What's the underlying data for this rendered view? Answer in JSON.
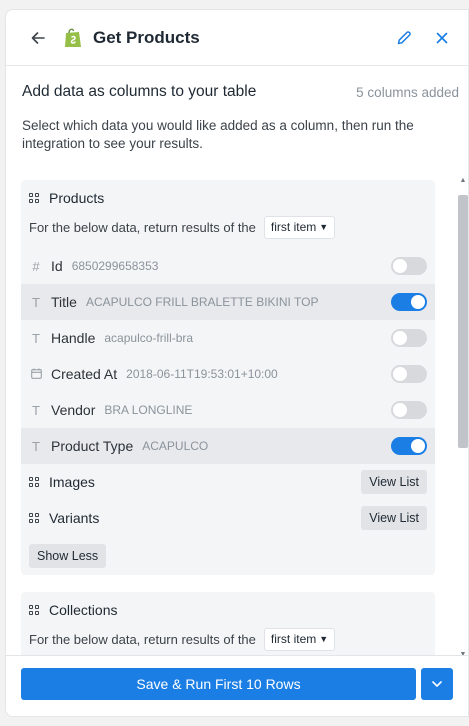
{
  "header": {
    "title": "Get Products",
    "back_icon": "arrow-left-icon",
    "logo_icon": "shopify-bag-icon",
    "edit_icon": "pencil-icon",
    "close_icon": "close-icon"
  },
  "intro": {
    "heading": "Add data as columns to your table",
    "count": "5 columns added",
    "description": "Select which data you would like added as a column, then run the integration to see your results."
  },
  "products": {
    "title": "Products",
    "return_text": "For the below data, return results of the",
    "return_select": "first item",
    "fields": [
      {
        "type_icon": "#",
        "label": "Id",
        "value": "6850299658353",
        "enabled": false
      },
      {
        "type_icon": "T",
        "label": "Title",
        "value": "ACAPULCO FRILL BRALETTE BIKINI TOP",
        "enabled": true
      },
      {
        "type_icon": "T",
        "label": "Handle",
        "value": "acapulco-frill-bra",
        "enabled": false
      },
      {
        "type_icon": "calendar",
        "label": "Created At",
        "value": "2018-06-11T19:53:01+10:00",
        "enabled": false
      },
      {
        "type_icon": "T",
        "label": "Vendor",
        "value": "BRA LONGLINE",
        "enabled": false
      },
      {
        "type_icon": "T",
        "label": "Product Type",
        "value": "ACAPULCO",
        "enabled": true
      }
    ],
    "sublists": [
      {
        "label": "Images",
        "button": "View List"
      },
      {
        "label": "Variants",
        "button": "View List"
      }
    ],
    "show_less": "Show Less"
  },
  "collections": {
    "title": "Collections",
    "return_text": "For the below data, return results of the",
    "return_select": "first item"
  },
  "footer": {
    "primary_label": "Save & Run First 10 Rows",
    "dropdown_icon": "chevron-down-icon"
  },
  "colors": {
    "accent": "#1a7ee4",
    "toggle_off": "#d7d9dd"
  }
}
